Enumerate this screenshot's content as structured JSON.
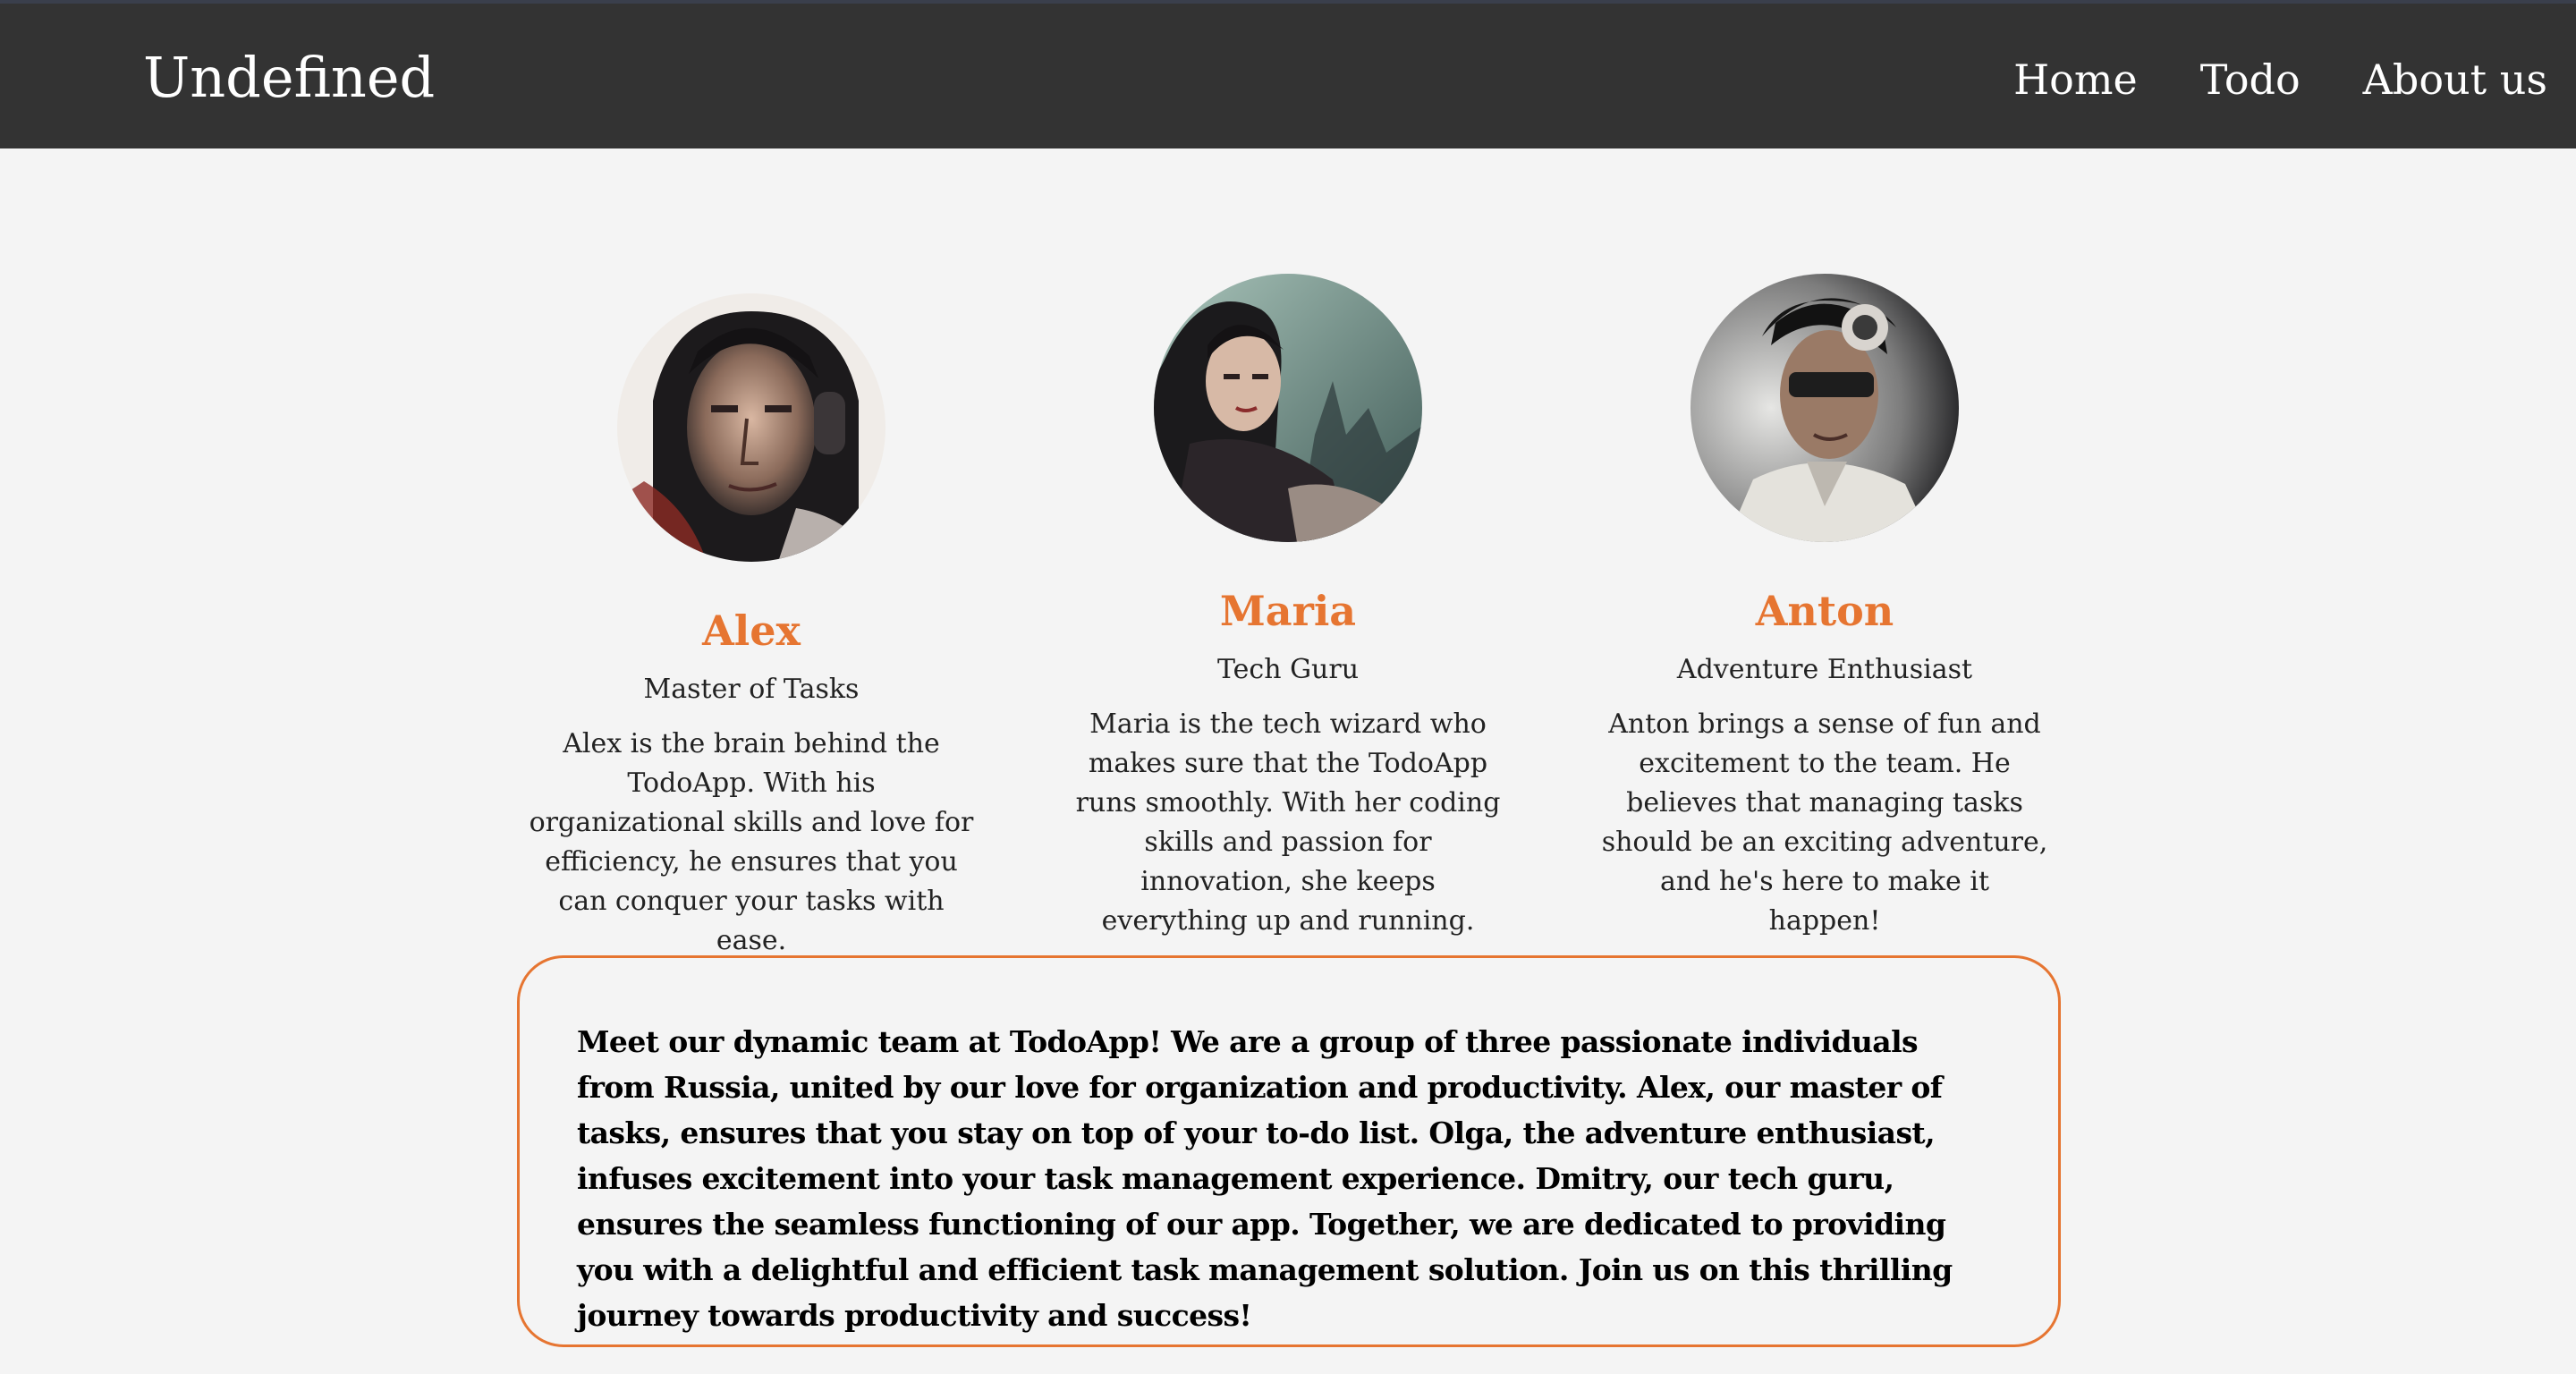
{
  "nav": {
    "brand": "Undefined",
    "links": [
      "Home",
      "Todo",
      "About us"
    ]
  },
  "team": [
    {
      "name": "Alex",
      "role": "Master of Tasks",
      "bio": "Alex is the brain behind the TodoApp. With his organizational skills and love for efficiency, he ensures that you can conquer your tasks with ease."
    },
    {
      "name": "Maria",
      "role": "Tech Guru",
      "bio": "Maria is the tech wizard who makes sure that the TodoApp runs smoothly. With her coding skills and passion for innovation, she keeps everything up and running."
    },
    {
      "name": "Anton",
      "role": "Adventure Enthusiast",
      "bio": "Anton brings a sense of fun and excitement to the team. He believes that managing tasks should be an exciting adventure, and he's here to make it happen!"
    }
  ],
  "about": "Meet our dynamic team at TodoApp! We are a group of three passionate individuals from Russia, united by our love for organization and productivity. Alex, our master of tasks, ensures that you stay on top of your to-do list. Olga, the adventure enthusiast, infuses excitement into your task management experience. Dmitry, our tech guru, ensures the seamless functioning of our app. Together, we are dedicated to providing you with a delightful and efficient task management solution. Join us on this thrilling journey towards productivity and success!",
  "colors": {
    "navbar": "#333333",
    "accent": "#e67531",
    "background": "#f4f4f4"
  }
}
